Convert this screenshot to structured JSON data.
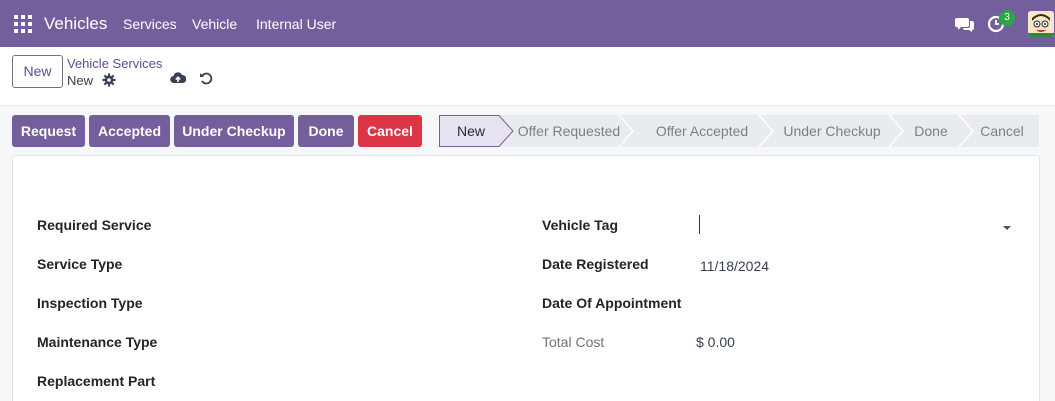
{
  "navbar": {
    "app_name": "Vehicles",
    "menu": [
      "Services",
      "Vehicle",
      "Internal User"
    ],
    "activity_count": "3",
    "icons": {
      "apps": "apps-grid-icon",
      "chat": "chat-icon",
      "activity": "clock-icon",
      "user": "avatar"
    }
  },
  "control": {
    "new_label": "New",
    "breadcrumb_parent": "Vehicle Services",
    "breadcrumb_current": "New",
    "icons": {
      "settings": "gear-icon",
      "save": "cloud-upload-icon",
      "discard": "undo-icon"
    }
  },
  "actions": [
    {
      "label": "Request",
      "type": "primary"
    },
    {
      "label": "Accepted",
      "type": "primary"
    },
    {
      "label": "Under Checkup",
      "type": "primary"
    },
    {
      "label": "Done",
      "type": "primary"
    },
    {
      "label": "Cancel",
      "type": "danger"
    }
  ],
  "stages": [
    {
      "label": "New",
      "active": true
    },
    {
      "label": "Offer Requested",
      "active": false
    },
    {
      "label": "Offer Accepted",
      "active": false
    },
    {
      "label": "Under Checkup",
      "active": false
    },
    {
      "label": "Done",
      "active": false
    },
    {
      "label": "Cancel",
      "active": false
    }
  ],
  "form": {
    "left_fields": [
      "Required Service",
      "Service Type",
      "Inspection Type",
      "Maintenance Type",
      "Replacement Part"
    ],
    "vehicle_tag_label": "Vehicle Tag",
    "vehicle_tag_value": "",
    "date_registered_label": "Date Registered",
    "date_registered_value": "11/18/2024",
    "date_appointment_label": "Date Of Appointment",
    "date_appointment_value": "",
    "total_cost_label": "Total Cost",
    "total_cost_value": "$ 0.00"
  },
  "colors": {
    "brand": "#735f9c",
    "danger": "#dc3545",
    "badge": "#28a745"
  }
}
